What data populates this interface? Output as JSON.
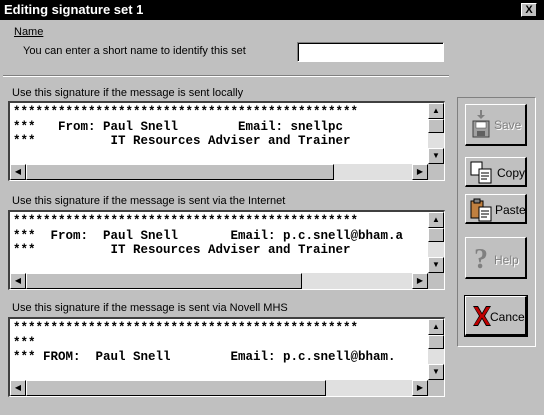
{
  "window": {
    "title": "Editing signature set 1",
    "close_label": "X"
  },
  "name_section": {
    "label": "Name",
    "hint": "You can enter a short name to identify this set",
    "value": ""
  },
  "signatures": [
    {
      "label": "Use this signature if the message is sent locally",
      "text": "**********************************************\n***   From: Paul Snell        Email: snellpc\n***          IT Resources Adviser and Trainer"
    },
    {
      "label": "Use this signature if the message is sent via the Internet",
      "text": "**********************************************\n***  From:  Paul Snell       Email: p.c.snell@bham.a\n***          IT Resources Adviser and Trainer"
    },
    {
      "label": "Use this signature if the message is sent via Novell MHS",
      "text": "**********************************************\n***\n*** FROM:  Paul Snell        Email: p.c.snell@bham."
    }
  ],
  "buttons": {
    "save": "Save",
    "copy": "Copy",
    "paste": "Paste",
    "help": "Help",
    "cancel": "Cancel"
  },
  "icons": {
    "save": "floppy-disk-icon",
    "copy": "copy-icon",
    "paste": "paste-icon",
    "help": "question-mark-icon",
    "cancel": "red-x-icon"
  }
}
